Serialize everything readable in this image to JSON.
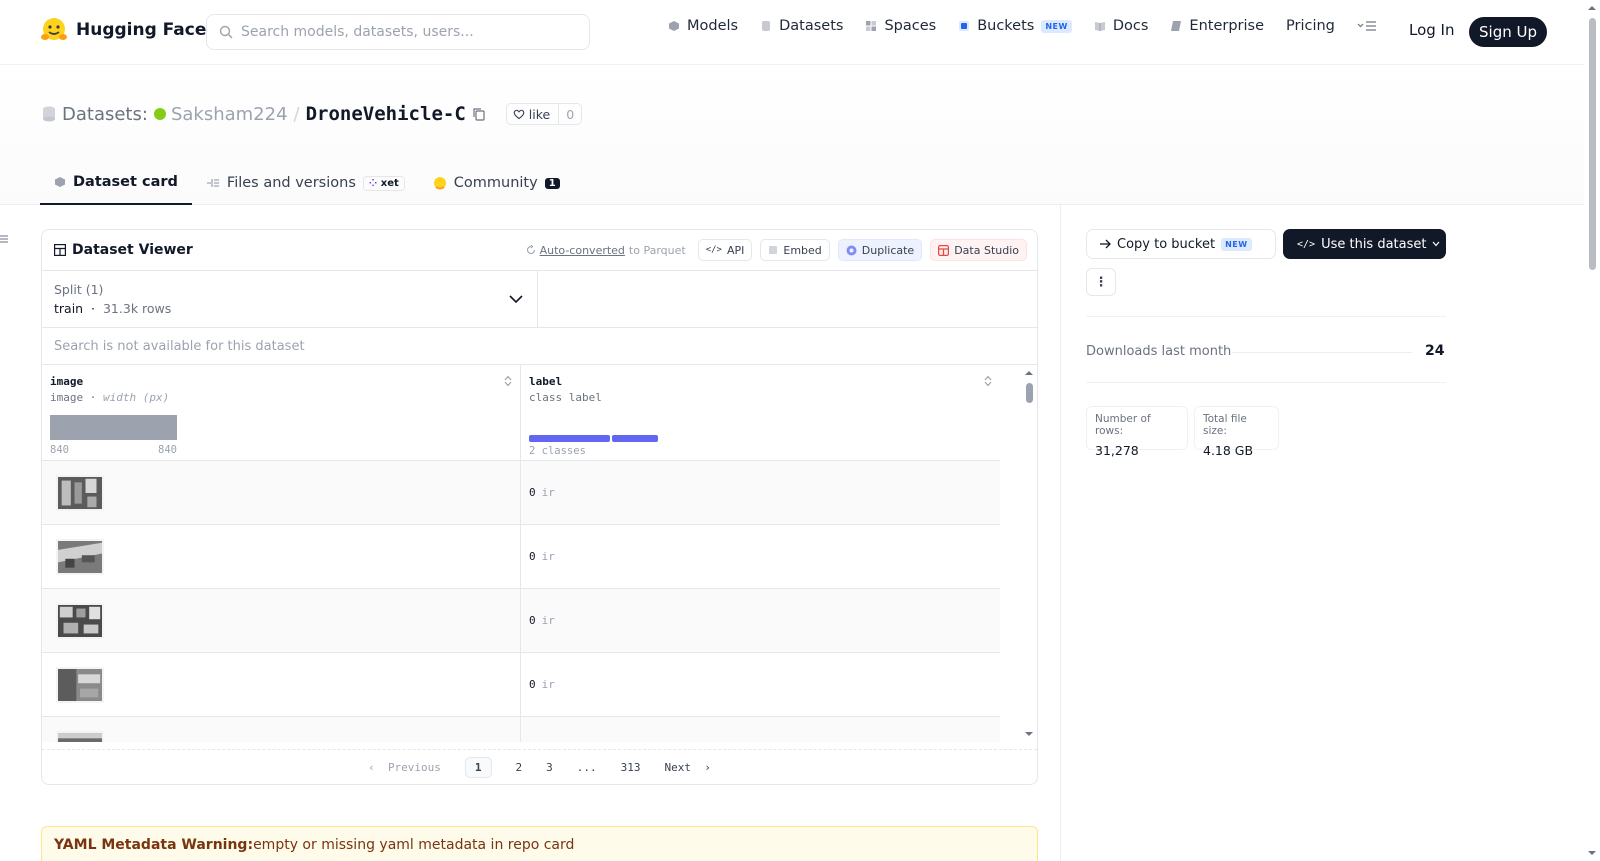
{
  "nav": {
    "brand": "Hugging Face",
    "search_placeholder": "Search models, datasets, users...",
    "links": [
      {
        "label": "Models"
      },
      {
        "label": "Datasets"
      },
      {
        "label": "Spaces"
      },
      {
        "label": "Buckets",
        "badge": "NEW"
      },
      {
        "label": "Docs"
      },
      {
        "label": "Enterprise"
      },
      {
        "label": "Pricing"
      }
    ],
    "login": "Log In",
    "signup": "Sign Up"
  },
  "header": {
    "section": "Datasets:",
    "user": "Saksham224",
    "separator": "/",
    "repo": "DroneVehicle-C",
    "like_label": "like",
    "like_count": "0",
    "tabs": [
      {
        "label": "Dataset card",
        "active": true
      },
      {
        "label": "Files and versions",
        "badge": "xet"
      },
      {
        "label": "Community",
        "count": "1"
      }
    ]
  },
  "viewer": {
    "title": "Dataset Viewer",
    "auto_converted": "Auto-converted",
    "to_parquet": "to Parquet",
    "buttons": {
      "api": "API",
      "embed": "Embed",
      "duplicate": "Duplicate",
      "studio": "Data Studio"
    },
    "split_label": "Split (1)",
    "split_name": "train",
    "split_rows": "31.3k rows",
    "search_disabled": "Search is not available for this dataset",
    "columns": {
      "image": {
        "name": "image",
        "type": "image",
        "subtype": "width (px)",
        "min": "840",
        "max": "840"
      },
      "label": {
        "name": "label",
        "type": "class label",
        "classes": "2 classes"
      }
    },
    "rows": [
      {
        "label_id": "0",
        "label_name": "ir"
      },
      {
        "label_id": "0",
        "label_name": "ir"
      },
      {
        "label_id": "0",
        "label_name": "ir"
      },
      {
        "label_id": "0",
        "label_name": "ir"
      },
      {
        "label_id": "",
        "label_name": ""
      }
    ],
    "pager": {
      "previous": "Previous",
      "pages": [
        "1",
        "2",
        "3",
        "...",
        "313"
      ],
      "next": "Next"
    }
  },
  "warning": {
    "title": "YAML Metadata Warning:",
    "text": "empty or missing yaml metadata in repo card"
  },
  "sidebar": {
    "copy_label": "Copy to bucket",
    "copy_badge": "NEW",
    "use_label": "Use this dataset",
    "more": "⋮",
    "downloads_label": "Downloads last month",
    "downloads_value": "24",
    "rows_label": "Number of rows:",
    "rows_value": "31,278",
    "size_label": "Total file size:",
    "size_value": "4.18 GB"
  }
}
